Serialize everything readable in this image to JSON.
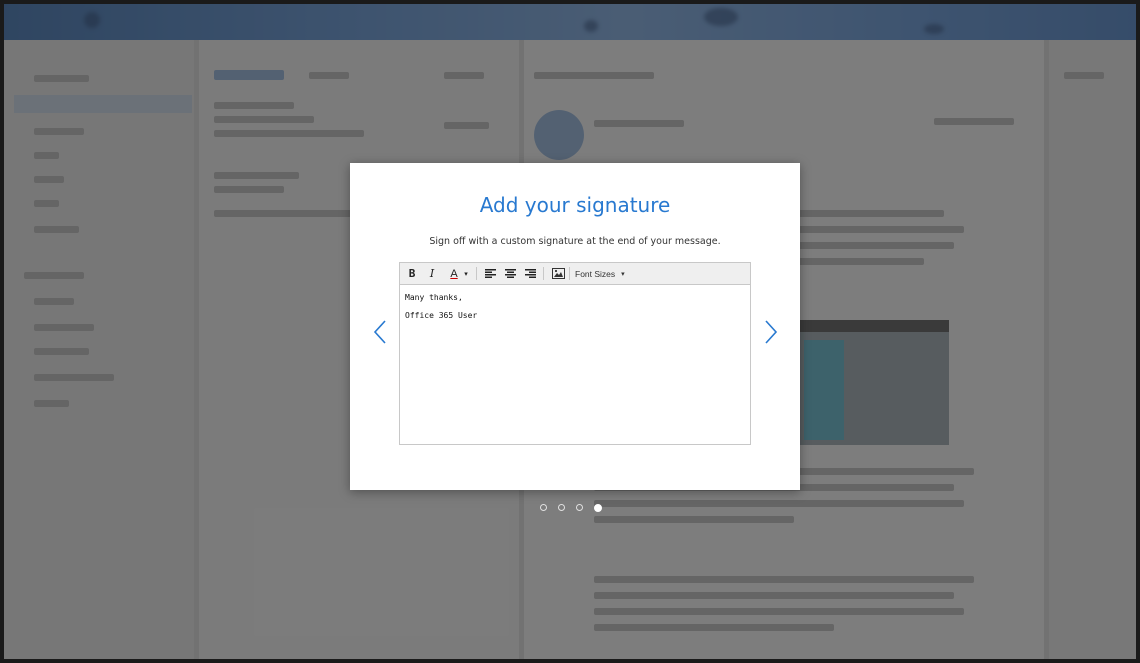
{
  "dialog": {
    "title": "Add your signature",
    "subtitle": "Sign off with a custom signature at the end of your message."
  },
  "toolbar": {
    "bold_label": "B",
    "italic_label": "I",
    "font_color_label": "A",
    "font_color_caret": "▾",
    "font_sizes_label": "Font Sizes",
    "font_sizes_caret": "▾",
    "icons": [
      "bold-icon",
      "italic-icon",
      "font-color-icon",
      "align-left-icon",
      "align-center-icon",
      "align-right-icon",
      "insert-image-icon"
    ]
  },
  "editor": {
    "lines": [
      "Many thanks,",
      "Office 365 User"
    ]
  },
  "pager": {
    "total": 4,
    "active_index": 3
  },
  "colors": {
    "accent": "#2879d0",
    "overlay": "#3a3a3a"
  }
}
